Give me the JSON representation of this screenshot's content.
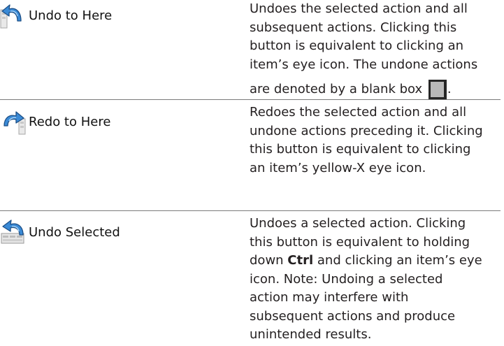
{
  "rows": [
    {
      "label": "Undo to Here",
      "icon": "undo-to-here-icon",
      "description_lines": [
        "Undoes the selected action and all",
        "subsequent actions. Clicking this",
        "button is equivalent to clicking an",
        "item’s eye icon. The undone actions"
      ],
      "description_tail": "are denoted by a blank box",
      "description_end": "."
    },
    {
      "label": "Redo to Here",
      "icon": "redo-to-here-icon",
      "description_lines": [
        "Redoes the selected action and all",
        "undone actions preceding it. Clicking",
        "this button is equivalent to clicking",
        "an item’s yellow-X eye icon."
      ]
    },
    {
      "label": "Undo Selected",
      "icon": "undo-selected-icon",
      "description_lines": [
        "Undoes a selected action. Clicking",
        "this button is equivalent to holding"
      ],
      "description_bold_word": "Ctrl",
      "description_after_bold": " and clicking an item’s eye",
      "description_lines_rest": [
        "icon. Note: Undoing a selected",
        "action may interfere with",
        "subsequent actions and produce",
        "unintended results."
      ],
      "description_before_bold": "down "
    }
  ],
  "colors": {
    "text": "#231f20",
    "divider": "#7a7a7a",
    "blank_box_fill": "#b9b9b9",
    "blank_box_border": "#262626",
    "icon_blue": "#2f7fc6"
  }
}
